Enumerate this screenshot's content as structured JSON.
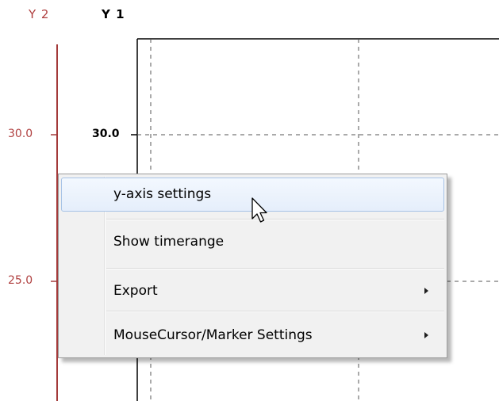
{
  "axes": {
    "y2": {
      "title": "Y 2",
      "tick_labels": [
        "30.0",
        "25.0"
      ],
      "color": "#b04040"
    },
    "y1": {
      "title": "Y 1",
      "tick_labels": [
        "30.0"
      ],
      "color": "#000000"
    }
  },
  "context_menu": {
    "items": [
      {
        "label": "y-axis settings",
        "has_submenu": false,
        "highlighted": true
      },
      {
        "label": "Show timerange",
        "has_submenu": false,
        "highlighted": false
      },
      {
        "label": "Export",
        "has_submenu": true,
        "highlighted": false
      },
      {
        "label": "MouseCursor/Marker Settings",
        "has_submenu": true,
        "highlighted": false
      }
    ],
    "highlight_color": "#e5eefb",
    "background_color": "#f1f1f1"
  },
  "cursor": {
    "icon": "arrow-pointer-icon"
  }
}
